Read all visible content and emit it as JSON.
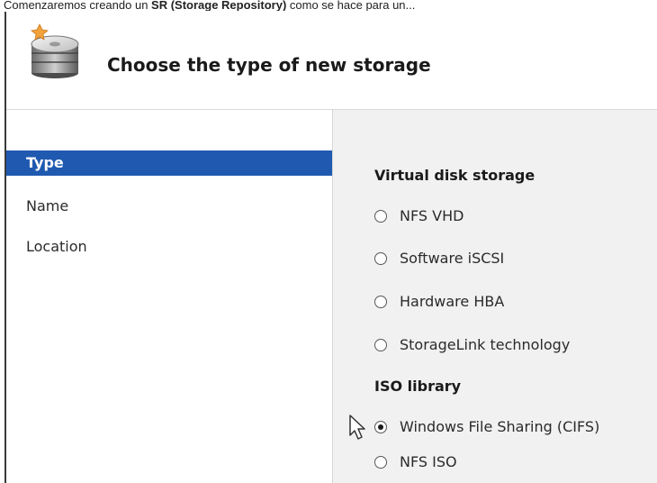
{
  "caption": {
    "prefix": "Comenzaremos creando un ",
    "bold": "SR (Storage Repository)",
    "suffix": " como se hace para un..."
  },
  "dialog": {
    "title": "Choose the type of new storage",
    "icon": "storage-disk-icon"
  },
  "nav": {
    "items": [
      {
        "label": "Type",
        "selected": true
      },
      {
        "label": "Name",
        "selected": false
      },
      {
        "label": "Location",
        "selected": false
      }
    ]
  },
  "content": {
    "virtual_disk_heading": "Virtual disk storage",
    "virtual_disk_options": [
      {
        "label": "NFS VHD",
        "checked": false
      },
      {
        "label": "Software iSCSI",
        "checked": false
      },
      {
        "label": "Hardware HBA",
        "checked": false
      },
      {
        "label": "StorageLink technology",
        "checked": false
      }
    ],
    "iso_heading": "ISO library",
    "iso_options": [
      {
        "label": "Windows File Sharing (CIFS)",
        "checked": true
      },
      {
        "label": "NFS ISO",
        "checked": false
      }
    ]
  },
  "colors": {
    "nav_selected": "#1f5ab0",
    "content_bg": "#f1f1f1"
  }
}
